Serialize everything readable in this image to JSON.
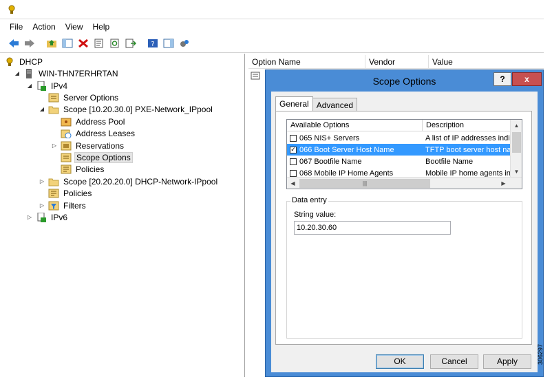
{
  "menu": [
    "File",
    "Action",
    "View",
    "Help"
  ],
  "toolbar": [
    "back-icon",
    "forward-icon",
    "up-folder-icon",
    "show-hide-tree-icon",
    "delete-icon",
    "properties-icon",
    "refresh-icon",
    "export-list-icon",
    "help-icon",
    "show-hide-action-pane-icon",
    "dhcp-settings-icon"
  ],
  "tree": {
    "root": "DHCP",
    "server": "WIN-THN7ERHRTAN",
    "ipv4": "IPv4",
    "server_options": "Server Options",
    "scope1": "Scope [10.20.30.0] PXE-Network_IPpool",
    "address_pool": "Address Pool",
    "address_leases": "Address Leases",
    "reservations": "Reservations",
    "scope_options": "Scope Options",
    "scope_policies": "Policies",
    "scope2": "Scope [20.20.20.0] DHCP-Network-IPpool",
    "policies": "Policies",
    "filters": "Filters",
    "ipv6": "IPv6"
  },
  "list_header": [
    "Option Name",
    "Vendor",
    "Value"
  ],
  "dialog": {
    "title": "Scope Options",
    "help": "?",
    "close": "x",
    "tabs": [
      "General",
      "Advanced"
    ],
    "options_columns": [
      "Available Options",
      "Description"
    ],
    "options": [
      {
        "name": "065 NIS+ Servers",
        "desc": "A list of IP addresses indica",
        "checked": false,
        "selected": false
      },
      {
        "name": "066 Boot Server Host Name",
        "desc": "TFTP boot server host nam",
        "checked": true,
        "selected": true
      },
      {
        "name": "067 Bootfile Name",
        "desc": "Bootfile Name",
        "checked": false,
        "selected": false
      },
      {
        "name": "068 Mobile IP Home Agents",
        "desc": "Mobile IP home agents in p",
        "checked": false,
        "selected": false
      }
    ],
    "data_entry_legend": "Data entry",
    "string_value_label": "String value:",
    "string_value": "10.20.30.60",
    "ok": "OK",
    "cancel": "Cancel",
    "apply": "Apply"
  },
  "figure_number": "306297",
  "colors": {
    "dialog_frame": "#4a8cd6",
    "close_button": "#c75050",
    "selection": "#3399ff"
  }
}
